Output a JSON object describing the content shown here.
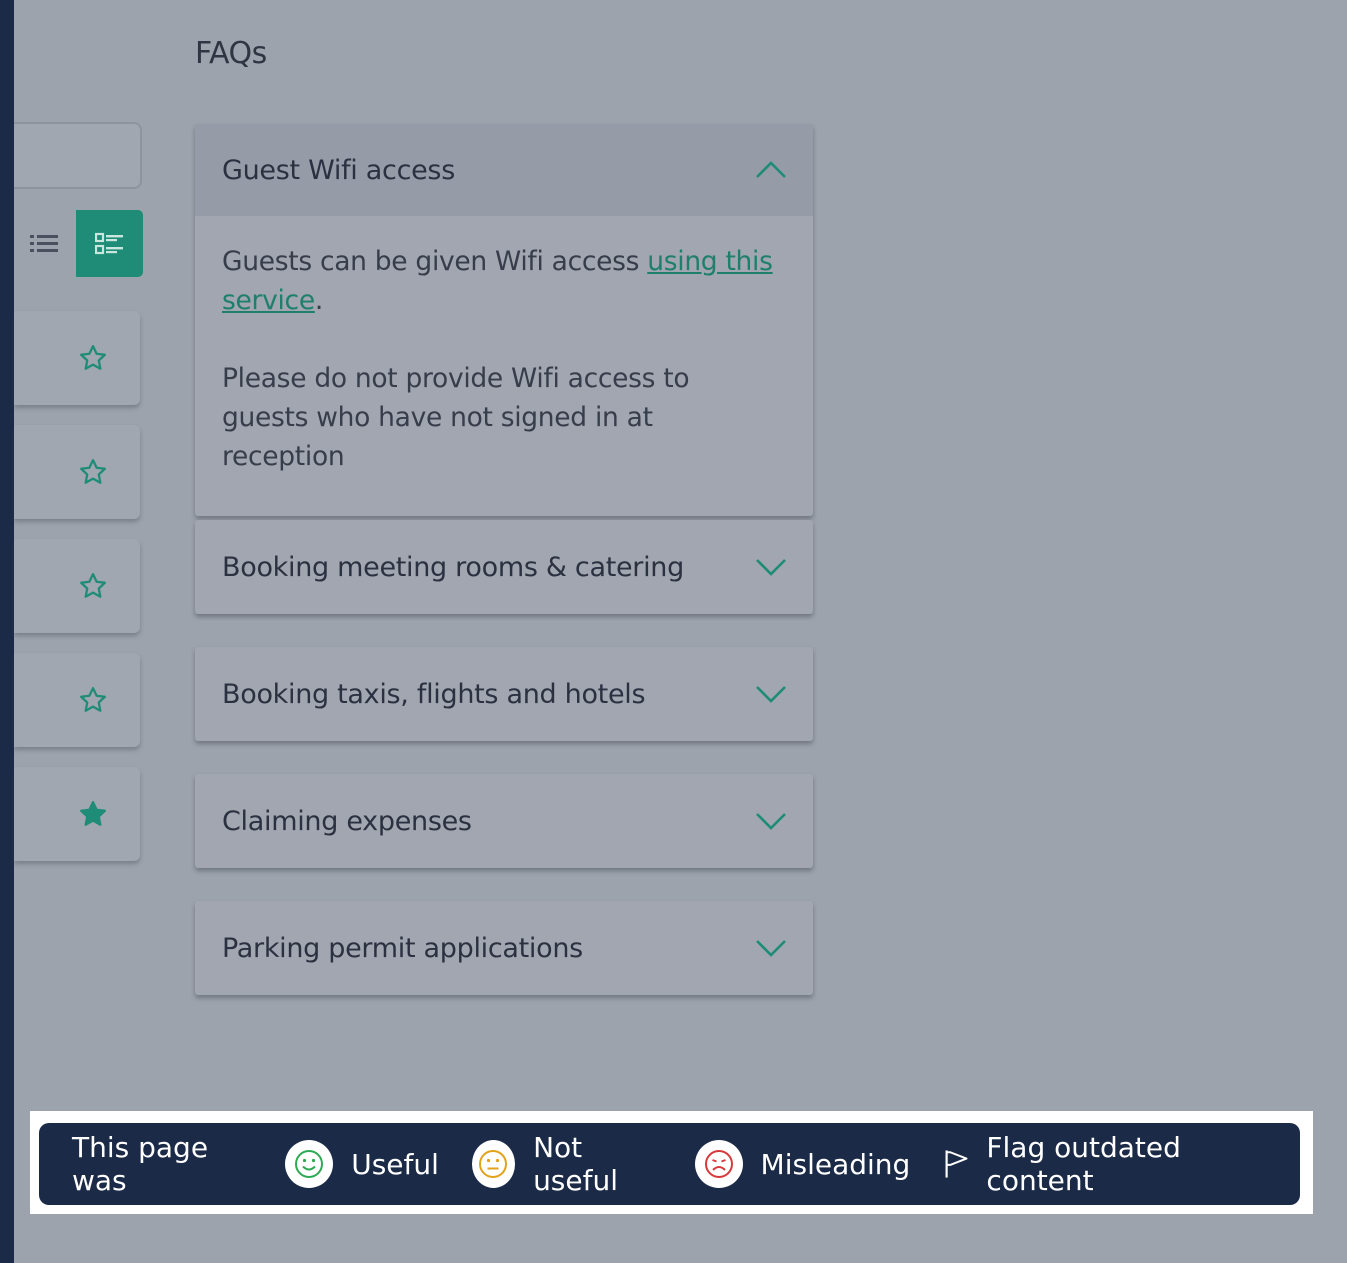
{
  "page": {
    "title": "FAQs"
  },
  "sidebar": {
    "cards": [
      {
        "favorited": false
      },
      {
        "favorited": false
      },
      {
        "favorited": false
      },
      {
        "favorited": false
      },
      {
        "favorited": true
      }
    ]
  },
  "faqs": [
    {
      "title": "Guest Wifi access",
      "expanded": true,
      "body_before_link": "Guests can be given Wifi access ",
      "link_text": "using this service",
      "body_after_link": ".",
      "paragraph2": "Please do not provide Wifi access to guests who have not signed in at reception"
    },
    {
      "title": "Booking meeting rooms & catering",
      "expanded": false
    },
    {
      "title": "Booking taxis, flights and hotels",
      "expanded": false
    },
    {
      "title": "Claiming expenses",
      "expanded": false
    },
    {
      "title": "Parking permit applications",
      "expanded": false
    }
  ],
  "feedback": {
    "prompt": "This page was",
    "useful": "Useful",
    "not_useful": "Not useful",
    "misleading": "Misleading",
    "flag": "Flag outdated content"
  },
  "colors": {
    "accent": "#1e8c76",
    "bar": "#1b2a47",
    "useful": "#2eaa55",
    "not_useful": "#e2a21b",
    "misleading": "#d63a3a"
  },
  "icons": [
    "list-view-icon",
    "card-view-icon",
    "star-outline-icon",
    "star-filled-icon",
    "chevron-up-icon",
    "chevron-down-icon",
    "smiley-happy-icon",
    "smiley-neutral-icon",
    "smiley-sad-icon",
    "flag-icon"
  ]
}
